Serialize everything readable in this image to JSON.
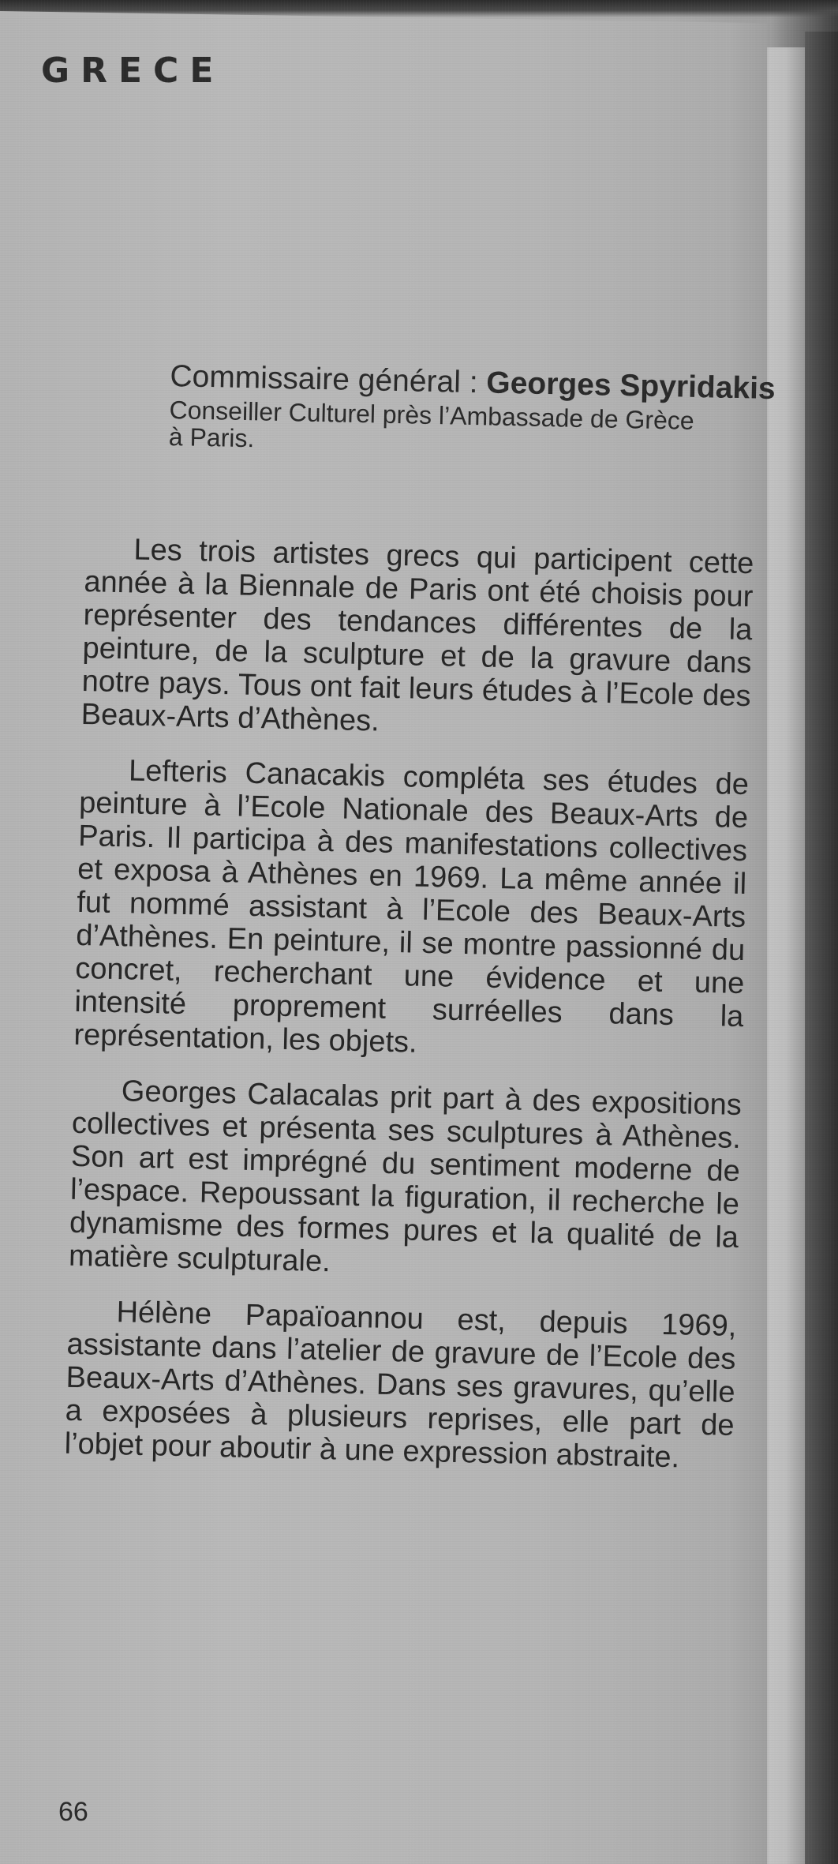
{
  "page": {
    "country": "GRECE",
    "page_number": "66"
  },
  "commissaire": {
    "label": "Commissaire général :",
    "name": "Georges Spyridakis",
    "role_line1": "Conseiller Culturel près l’Ambassade de Grèce",
    "role_line2": "à Paris."
  },
  "body": {
    "paragraphs": [
      "Les trois artistes grecs qui participent cette année à la Biennale de Paris ont été choisis pour représenter des tendances différentes de la peinture, de la sculpture et de la gravure dans notre pays. Tous ont fait leurs études à l’Ecole des Beaux-Arts d’Athènes.",
      "Lefteris Canacakis compléta ses études de peinture à l’Ecole Nationale des Beaux-Arts de Paris. Il participa à des manifestations collectives et exposa à Athènes en 1969. La même année il fut nommé assistant à l’Ecole des Beaux-Arts d’Athènes. En peinture, il se montre passionné du concret, recherchant une évidence et une intensité proprement surréelles dans la représentation, les objets.",
      "Georges Calacalas prit part à des expositions collectives et présenta ses sculptures à Athènes. Son art est imprégné du sentiment moderne de l’espace. Repoussant la figuration, il recherche le dynamisme des formes pures et la qualité de la matière sculpturale.",
      "Hélène Papaïoannou est, depuis 1969, assistante dans l’atelier de gravure de l’Ecole des Beaux-Arts d’Athènes. Dans ses gravures, qu’elle a exposées à plusieurs reprises, elle part de l’objet pour aboutir à une expression abstraite."
    ]
  }
}
